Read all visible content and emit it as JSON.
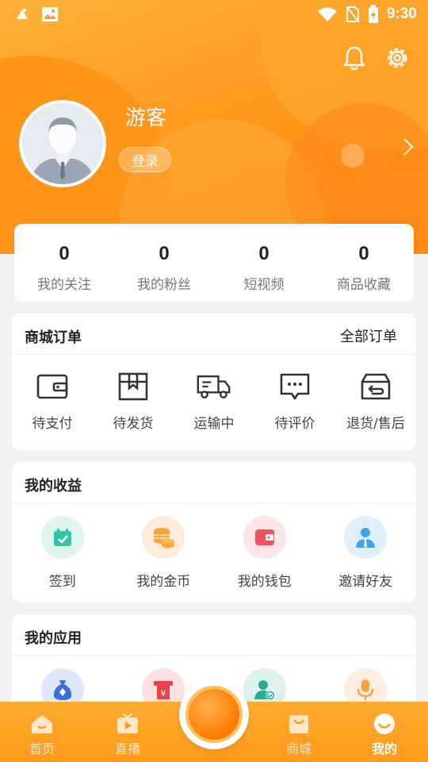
{
  "status_bar": {
    "time": "9:30"
  },
  "profile": {
    "username": "游客",
    "login_label": "登录"
  },
  "stats": [
    {
      "value": "0",
      "label": "我的关注"
    },
    {
      "value": "0",
      "label": "我的粉丝"
    },
    {
      "value": "0",
      "label": "短视频"
    },
    {
      "value": "0",
      "label": "商品收藏"
    }
  ],
  "orders": {
    "title": "商城订单",
    "all_label": "全部订单",
    "items": [
      {
        "label": "待支付",
        "icon": "wallet-icon"
      },
      {
        "label": "待发货",
        "icon": "package-icon"
      },
      {
        "label": "运输中",
        "icon": "truck-icon"
      },
      {
        "label": "待评价",
        "icon": "comment-icon"
      },
      {
        "label": "退货/售后",
        "icon": "return-box-icon"
      }
    ]
  },
  "earnings": {
    "title": "我的收益",
    "items": [
      {
        "label": "签到",
        "icon": "calendar-check-icon",
        "color": "#2ec4a6"
      },
      {
        "label": "我的金币",
        "icon": "coins-icon",
        "color": "#f7a43a"
      },
      {
        "label": "我的钱包",
        "icon": "wallet-red-icon",
        "color": "#f0525b"
      },
      {
        "label": "邀请好友",
        "icon": "user-tie-icon",
        "color": "#3aa6e8"
      }
    ]
  },
  "apps": {
    "title": "我的应用",
    "items": [
      {
        "icon": "money-bag-icon"
      },
      {
        "icon": "receipt-icon"
      },
      {
        "icon": "verified-user-icon"
      },
      {
        "icon": "microphone-icon"
      }
    ]
  },
  "tabbar": [
    {
      "label": "首页",
      "icon": "home-icon"
    },
    {
      "label": "直播",
      "icon": "live-tv-icon"
    },
    {
      "label": "商城",
      "icon": "shop-bag-icon"
    },
    {
      "label": "我的",
      "icon": "profile-smile-icon",
      "active": true
    }
  ],
  "colors": {
    "accent": "#ff9a1c",
    "background": "#f2f2f5"
  }
}
